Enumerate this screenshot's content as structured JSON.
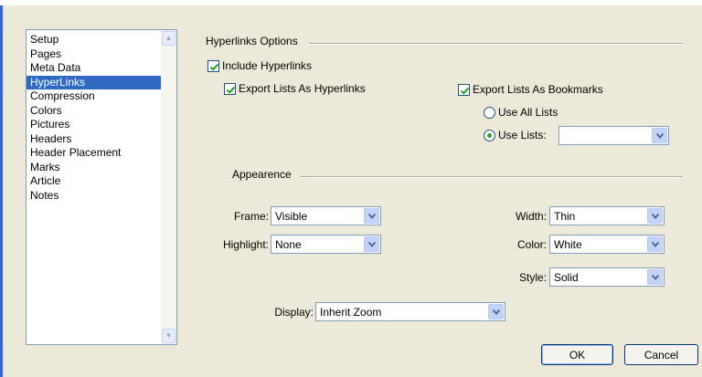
{
  "categories": {
    "items": [
      "Setup",
      "Pages",
      "Meta Data",
      "HyperLinks",
      "Compression",
      "Colors",
      "Pictures",
      "Headers",
      "Header Placement",
      "Marks",
      "Article",
      "Notes"
    ],
    "selected": "HyperLinks"
  },
  "hyperlinks": {
    "group_title": "Hyperlinks Options",
    "include_hyperlinks": {
      "label": "Include Hyperlinks",
      "checked": true
    },
    "export_lists_hyperlinks": {
      "label": "Export Lists As Hyperlinks",
      "checked": true
    },
    "export_lists_bookmarks": {
      "label": "Export Lists As Bookmarks",
      "checked": true
    },
    "use_all_lists": {
      "label": "Use All Lists",
      "selected": false
    },
    "use_lists": {
      "label": "Use Lists:",
      "selected": true,
      "value": ""
    }
  },
  "appearance": {
    "group_title": "Appearence",
    "frame": {
      "label": "Frame:",
      "value": "Visible"
    },
    "highlight": {
      "label": "Highlight:",
      "value": "None"
    },
    "width": {
      "label": "Width:",
      "value": "Thin"
    },
    "color": {
      "label": "Color:",
      "value": "White"
    },
    "style": {
      "label": "Style:",
      "value": "Solid"
    },
    "display": {
      "label": "Display:",
      "value": "Inherit Zoom"
    }
  },
  "buttons": {
    "ok": "OK",
    "cancel": "Cancel"
  },
  "colors": {
    "selection": "#316ac5",
    "dialog_bg": "#ece9d8",
    "check": "#21a121"
  }
}
